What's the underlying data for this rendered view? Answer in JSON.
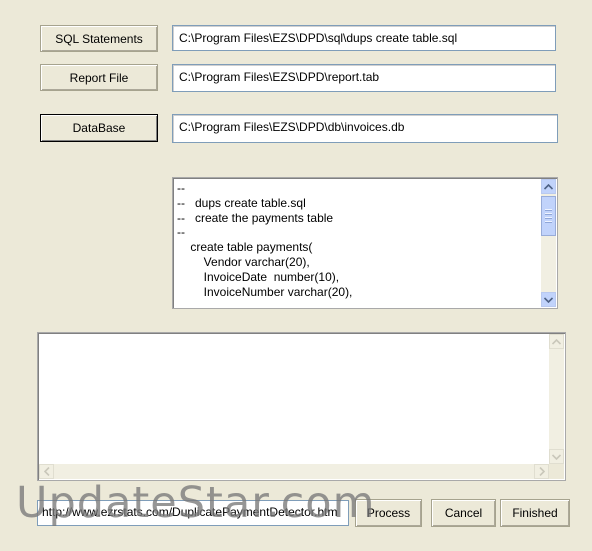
{
  "buttons": {
    "sql": "SQL Statements",
    "report": "Report File",
    "database": "DataBase",
    "process": "Process",
    "cancel": "Cancel",
    "finished": "Finished"
  },
  "fields": {
    "sql_path": "C:\\Program Files\\EZS\\DPD\\sql\\dups create table.sql",
    "report_path": "C:\\Program Files\\EZS\\DPD\\report.tab",
    "db_path": "C:\\Program Files\\EZS\\DPD\\db\\invoices.db",
    "url": "http://www.ezrstats.com/DuplicatePaymentDetector.htm"
  },
  "sql_preview": "--\n--   dups create table.sql\n--   create the payments table\n--\n    create table payments(\n        Vendor varchar(20),\n        InvoiceDate  number(10),\n        InvoiceNumber varchar(20),",
  "output_text": "",
  "watermark": "UpdateStar.com",
  "icons": {
    "scroll_up": "arrow-up-icon",
    "scroll_down": "arrow-down-icon",
    "scroll_left": "arrow-left-icon",
    "scroll_right": "arrow-right-icon"
  }
}
